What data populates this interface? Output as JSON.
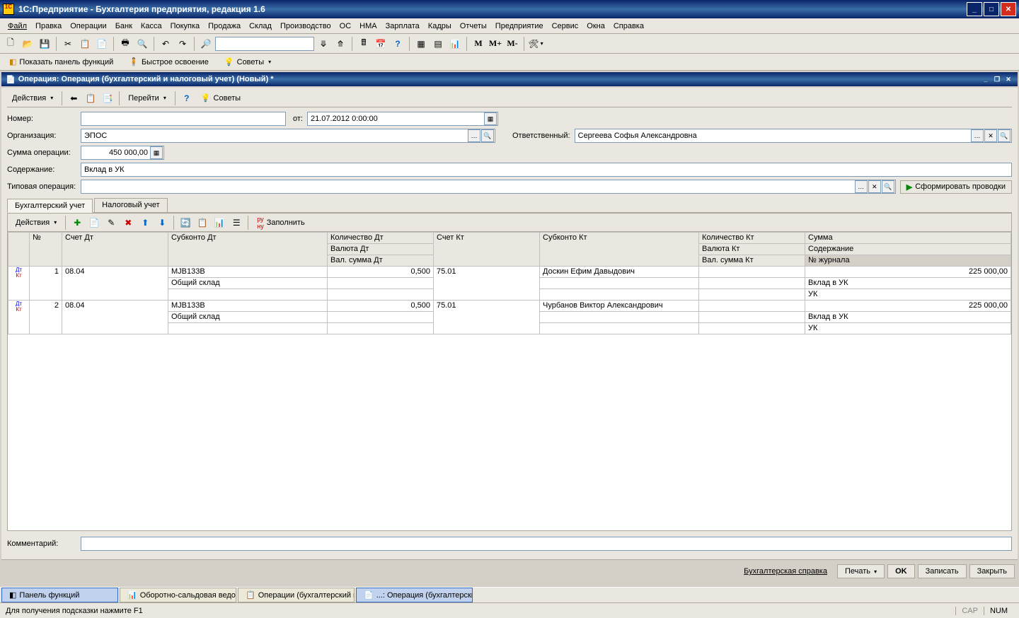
{
  "titlebar": "1C:Предприятие  - Бухгалтерия предприятия, редакция 1.6",
  "menu": [
    "Файл",
    "Правка",
    "Операции",
    "Банк",
    "Касса",
    "Покупка",
    "Продажа",
    "Склад",
    "Производство",
    "ОС",
    "НМА",
    "Зарплата",
    "Кадры",
    "Отчеты",
    "Предприятие",
    "Сервис",
    "Окна",
    "Справка"
  ],
  "secondbar": {
    "b1": "Показать панель функций",
    "b2": "Быстрое освоение",
    "b3": "Советы"
  },
  "inner_title": "Операция: Операция (бухгалтерский и налоговый учет) (Новый) *",
  "form_toolbar": {
    "actions": "Действия",
    "go": "Перейти",
    "tips": "Советы"
  },
  "labels": {
    "number": "Номер:",
    "from": "от:",
    "org": "Организация:",
    "resp": "Ответственный:",
    "sum": "Сумма операции:",
    "content": "Содержание:",
    "typical": "Типовая операция:",
    "comment": "Комментарий:"
  },
  "values": {
    "number": "",
    "date": "21.07.2012  0:00:00",
    "org": "ЭПОС",
    "resp": "Сергеева Софья Александровна",
    "sum": "450 000,00",
    "content": "Вклад в УК",
    "typical": "",
    "comment": ""
  },
  "gen_btn": "Сформировать проводки",
  "tabs": {
    "t1": "Бухгалтерский учет",
    "t2": "Налоговый учет"
  },
  "grid_toolbar": {
    "actions": "Действия",
    "fill": "Заполнить"
  },
  "headers": {
    "n": "№",
    "acc_dt": "Счет Дт",
    "sub_dt": "Субконто Дт",
    "qty_dt": "Количество Дт",
    "cur_dt": "Валюта Дт",
    "vsum_dt": "Вал. сумма Дт",
    "acc_kt": "Счет Кт",
    "sub_kt": "Субконто Кт",
    "qty_kt": "Количество Кт",
    "cur_kt": "Валюта Кт",
    "vsum_kt": "Вал. сумма Кт",
    "sum": "Сумма",
    "cont": "Содержание",
    "journal": "№ журнала"
  },
  "rows": [
    {
      "n": "1",
      "acc_dt": "08.04",
      "sub_dt1": "MJB133B",
      "sub_dt2": "Общий склад",
      "qty_dt": "0,500",
      "acc_kt": "75.01",
      "sub_kt": "Доскин Ефим Давыдович",
      "sum": "225 000,00",
      "cont": "Вклад в УК",
      "journal": "УК"
    },
    {
      "n": "2",
      "acc_dt": "08.04",
      "sub_dt1": "MJB133B",
      "sub_dt2": "Общий склад",
      "qty_dt": "0,500",
      "acc_kt": "75.01",
      "sub_kt": "Чурбанов Виктор Александрович",
      "sum": "225 000,00",
      "cont": "Вклад в УК",
      "journal": "УК"
    }
  ],
  "bottom": {
    "ref": "Бухгалтерская справка",
    "print": "Печать",
    "ok": "OK",
    "save": "Записать",
    "close": "Закрыть"
  },
  "tasks": [
    {
      "label": "Панель функций",
      "active": true
    },
    {
      "label": "Оборотно-сальдовая ведом...",
      "active": false
    },
    {
      "label": "Операции (бухгалтерский и...",
      "active": false
    },
    {
      "label": "...: Операция (бухгалтерски...",
      "active": true
    }
  ],
  "status": {
    "main": "Для получения подсказки нажмите F1",
    "cap": "CAP",
    "num": "NUM"
  }
}
